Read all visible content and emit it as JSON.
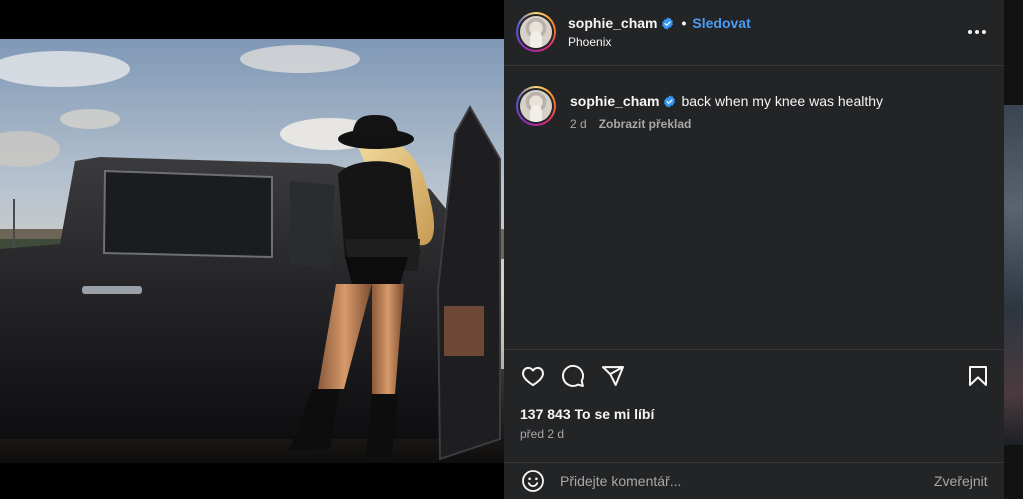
{
  "post": {
    "username": "sophie_cham",
    "follow_label": "Sledovat",
    "separator": "•",
    "location": "Phoenix"
  },
  "caption": {
    "username": "sophie_cham",
    "text": "back when my knee was healthy",
    "age": "2 d",
    "translate_label": "Zobrazit překlad"
  },
  "stats": {
    "likes": "137 843 To se mi líbí",
    "posted": "před 2 d"
  },
  "comment": {
    "placeholder": "Přidejte komentář...",
    "post_label": "Zveřejnit"
  },
  "icons": {
    "more": "more-options-icon",
    "verified": "verified-badge-icon",
    "like": "heart-icon",
    "comment": "comment-bubble-icon",
    "share": "paper-plane-icon",
    "save": "bookmark-icon",
    "emoji": "smiley-icon"
  },
  "colors": {
    "panel_bg": "#232426",
    "link_blue": "#4a9cf5",
    "muted_text": "#a8a8a8",
    "divider": "#363636"
  }
}
